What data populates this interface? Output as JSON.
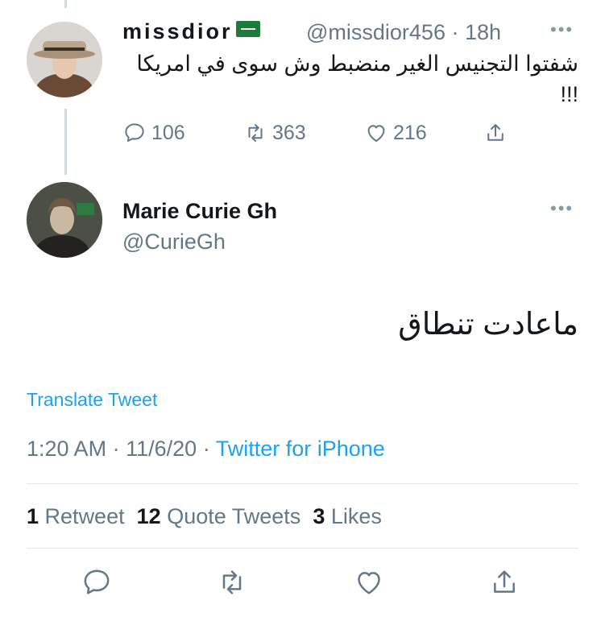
{
  "original_tweet": {
    "display_name": "missdior",
    "flag_icon": "saudi-flag-icon",
    "handle": "@missdior456",
    "separator": "·",
    "time_ago": "18h",
    "more_icon": "ellipsis-icon",
    "text_line1": "شفتوا التجنيس الغير منضبط وش سوى في امريكا",
    "text_line2": "!!!",
    "actions": {
      "reply_count": "106",
      "retweet_count": "363",
      "like_count": "216"
    }
  },
  "reply_tweet": {
    "display_name": "Marie Curie Gh",
    "handle": "@CurieGh",
    "more_icon": "ellipsis-icon",
    "text": "ماعادت تنطاق",
    "translate_label": "Translate Tweet",
    "time": "1:20 AM",
    "dot": "·",
    "date": "11/6/20",
    "source": "Twitter for iPhone",
    "stats": {
      "retweet_count": "1",
      "retweet_label": "Retweet",
      "quote_count": "12",
      "quote_label": "Quote Tweets",
      "like_count": "3",
      "like_label": "Likes"
    }
  },
  "colors": {
    "link_blue": "#1da1f2",
    "muted_gray": "#657786",
    "text_dark": "#14171a",
    "divider": "#e1e8ed"
  }
}
